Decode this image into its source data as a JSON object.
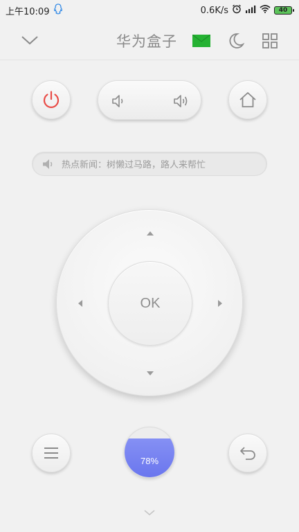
{
  "status_bar": {
    "time": "上午10:09",
    "speed": "0.6K/s",
    "battery": "40"
  },
  "header": {
    "title": "华为盒子",
    "icons": [
      "chevron-down-icon",
      "message-icon",
      "moon-icon",
      "grid-icon"
    ]
  },
  "controls": {
    "icons": [
      "power-icon",
      "volume-down-icon",
      "volume-up-icon",
      "home-icon",
      "menu-icon",
      "back-icon"
    ]
  },
  "news": {
    "text": "热点新闻：树懒过马路，路人来帮忙"
  },
  "dpad": {
    "ok_label": "OK"
  },
  "memory": {
    "percent_label": "78%",
    "fill_fraction": 0.78
  },
  "colors": {
    "power": "#e94b46",
    "message": "#25b233",
    "ball_fill": "#6a76ee"
  }
}
